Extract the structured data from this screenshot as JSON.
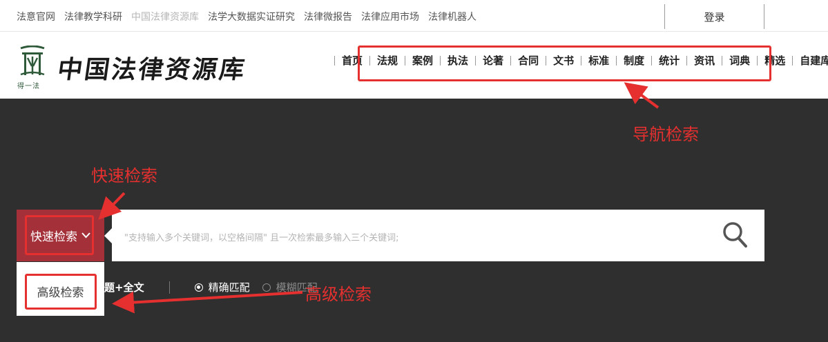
{
  "topbar": {
    "links": [
      "法意官网",
      "法律教学科研",
      "中国法律资源库",
      "法学大数据实证研究",
      "法律微报告",
      "法律应用市场",
      "法律机器人"
    ],
    "active_index": 2,
    "login_label": "登录"
  },
  "header": {
    "logo_text": "中国法律资源库",
    "logo_sub": "得一法",
    "nav_home": "首页",
    "nav_items": [
      "法规",
      "案例",
      "执法",
      "论著",
      "合同",
      "文书",
      "标准",
      "制度",
      "统计",
      "资讯",
      "词典",
      "精选",
      "自建库"
    ]
  },
  "search": {
    "mode_label": "快速检索",
    "placeholder": "\"支持输入多个关键词，以空格间隔\" 且一次检索最多输入三个关键词;",
    "dropdown_item": "高级检索",
    "scope_label": "题+全文",
    "match_exact": "精确匹配",
    "match_fuzzy": "模糊匹配",
    "exact_selected": true
  },
  "annotations": {
    "nav_label": "导航检索",
    "quick_label": "快速检索",
    "advanced_label": "高级检索",
    "color": "#e5302f"
  },
  "colors": {
    "hero_bg": "#2f2f2f",
    "accent": "#a4303a",
    "logo_green": "#2e5a3a"
  }
}
